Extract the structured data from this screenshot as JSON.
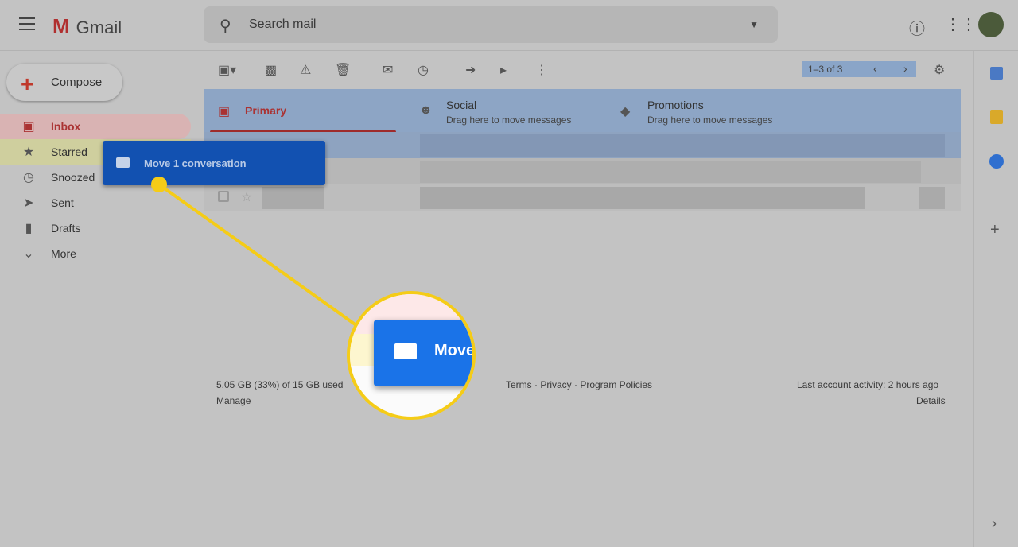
{
  "header": {
    "app_name": "Gmail",
    "search_placeholder": "Search mail",
    "icons": [
      "menu-icon",
      "help-icon",
      "apps-icon",
      "avatar"
    ]
  },
  "compose_label": "Compose",
  "nav": [
    {
      "label": "Inbox",
      "icon": "inbox-icon",
      "active": true
    },
    {
      "label": "Starred",
      "icon": "star-icon"
    },
    {
      "label": "Snoozed",
      "icon": "clock-icon"
    },
    {
      "label": "Sent",
      "icon": "send-icon"
    },
    {
      "label": "Drafts",
      "icon": "draft-icon"
    },
    {
      "label": "More",
      "icon": "chevron-down-icon"
    }
  ],
  "toolbar": {
    "pager": "1–3 of 3"
  },
  "tabs": [
    {
      "label": "Primary",
      "sub": ""
    },
    {
      "label": "Social",
      "sub": "Drag here to move messages"
    },
    {
      "label": "Promotions",
      "sub": "Drag here to move messages"
    }
  ],
  "drag": {
    "label": "Move 1 conversation",
    "zoom_label": "Move"
  },
  "footer": {
    "storage": "5.05 GB (33%) of 15 GB used",
    "manage": "Manage",
    "links": "Terms · Privacy · Program Policies",
    "activity": "Last account activity: 2 hours ago",
    "details": "Details"
  },
  "colors": {
    "accent_red": "#a33333",
    "drag_blue": "#1251b1",
    "callout_yellow": "#f5cc17",
    "tab_drop_blue": "#8da5c5"
  }
}
